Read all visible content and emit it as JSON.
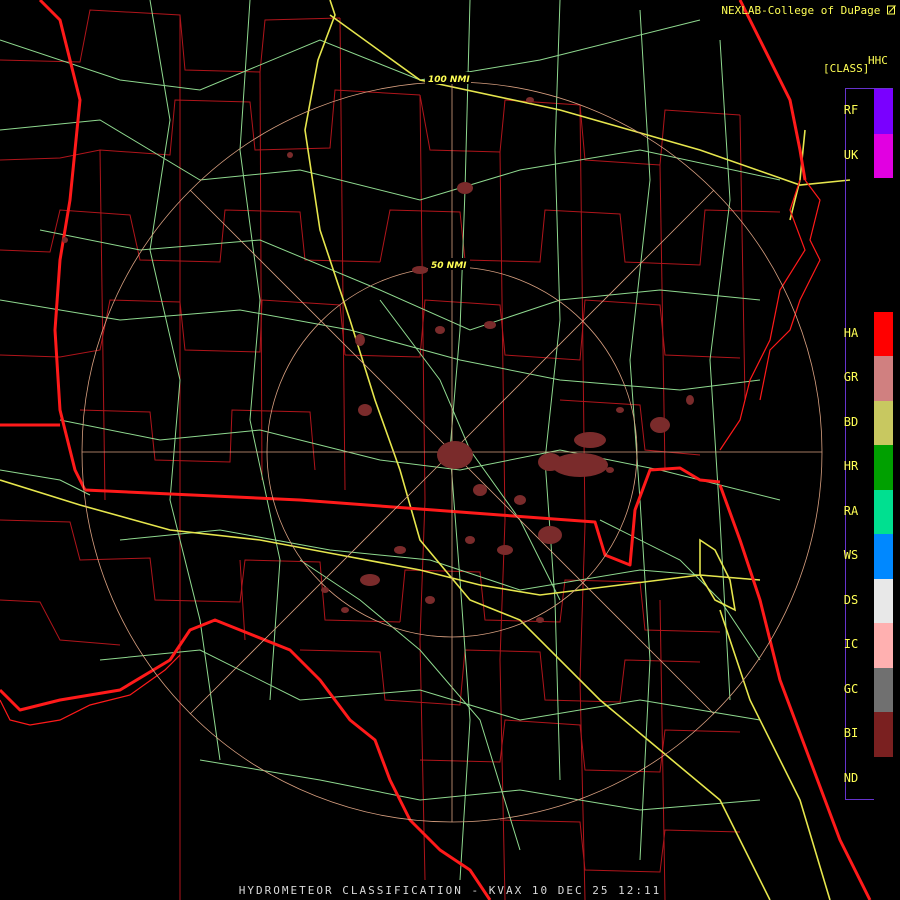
{
  "credit": "NEXLAB-College of DuPage",
  "credit_icon": "edit-icon",
  "product_code": "HHC",
  "product_sub": "[CLASS]",
  "footer": "HYDROMETEOR CLASSIFICATION - KVAX 10 DEC 25 12:11",
  "rings": {
    "outer_label": "100 NMI",
    "inner_label": "50 NMI"
  },
  "colors": {
    "state_border": "#ff1a1a",
    "county_border": "#b0151b",
    "highway": "#e6e64d",
    "road": "#8fd98f",
    "range_ring": "#d9a080",
    "echo": "#7a2b2b"
  },
  "legend": [
    {
      "code": "RF",
      "color": "#7a00ff"
    },
    {
      "code": "UK",
      "color": "#e100e1"
    },
    {
      "code": "",
      "color": "#000000"
    },
    {
      "code": "",
      "color": "#000000"
    },
    {
      "code": "",
      "color": "#000000"
    },
    {
      "code": "HA",
      "color": "#ff0000"
    },
    {
      "code": "GR",
      "color": "#d08080"
    },
    {
      "code": "BD",
      "color": "#c8c860"
    },
    {
      "code": "HR",
      "color": "#00a000"
    },
    {
      "code": "RA",
      "color": "#00e090"
    },
    {
      "code": "WS",
      "color": "#0088ff"
    },
    {
      "code": "DS",
      "color": "#e8e8e8"
    },
    {
      "code": "IC",
      "color": "#ffb0b0"
    },
    {
      "code": "GC",
      "color": "#707070"
    },
    {
      "code": "BI",
      "color": "#7a2020"
    },
    {
      "code": "ND",
      "color": "#000000"
    }
  ]
}
